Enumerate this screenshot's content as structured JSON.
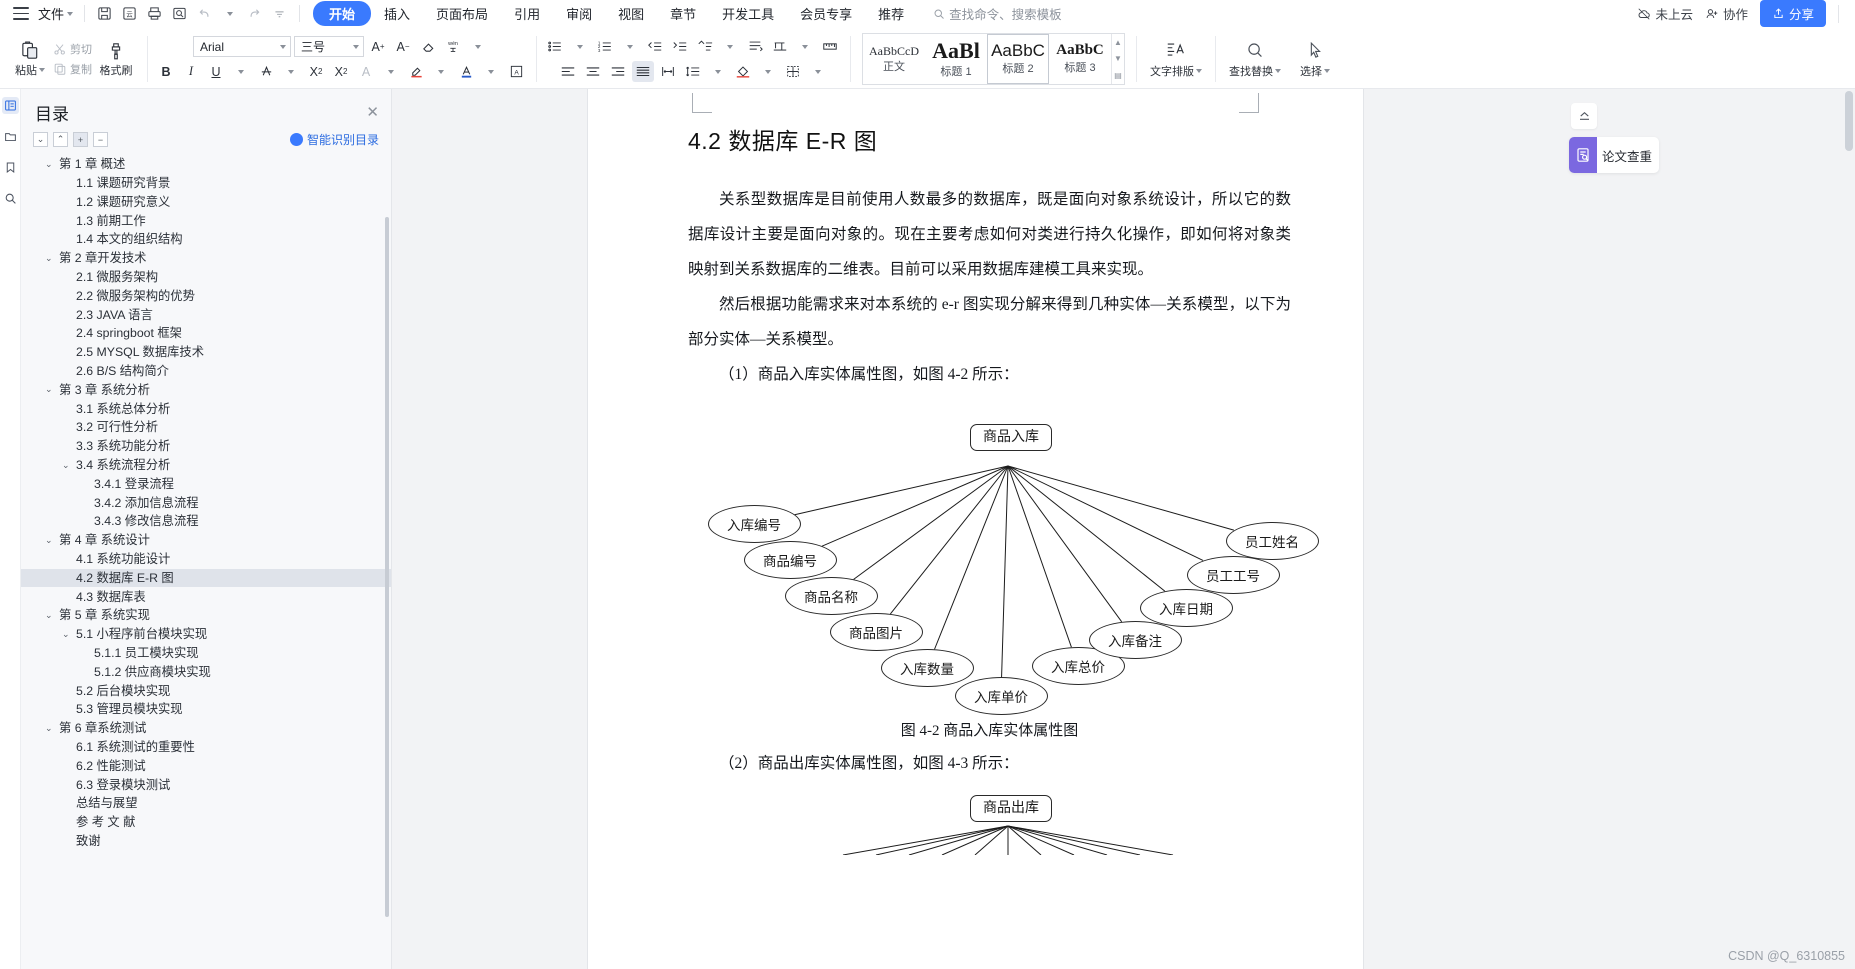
{
  "menubar": {
    "file_label": "文件",
    "quick_icons": [
      "save-icon",
      "save-as-cloud-icon",
      "print-icon",
      "print-preview-icon",
      "undo-icon",
      "redo-icon",
      "customize-icon"
    ],
    "tabs": [
      {
        "label": "开始",
        "active": true
      },
      {
        "label": "插入",
        "active": false
      },
      {
        "label": "页面布局",
        "active": false
      },
      {
        "label": "引用",
        "active": false
      },
      {
        "label": "审阅",
        "active": false
      },
      {
        "label": "视图",
        "active": false
      },
      {
        "label": "章节",
        "active": false
      },
      {
        "label": "开发工具",
        "active": false
      },
      {
        "label": "会员专享",
        "active": false
      },
      {
        "label": "推荐",
        "active": false
      }
    ],
    "search_placeholder": "查找命令、搜索模板",
    "cloud_status": "未上云",
    "collab_label": "协作",
    "share_label": "分享"
  },
  "ribbon": {
    "paste_label": "粘贴",
    "cut_label": "剪切",
    "copy_label": "复制",
    "format_painter_label": "格式刷",
    "font_name": "Arial",
    "font_size": "三号",
    "styles": [
      {
        "preview": "AaBbCcD",
        "name": "正文",
        "selected": false
      },
      {
        "preview": "AaBl",
        "name": "标题 1",
        "selected": false
      },
      {
        "preview": "AaBbC",
        "name": "标题 2",
        "selected": true
      },
      {
        "preview": "AaBbC",
        "name": "标题 3",
        "selected": false
      }
    ],
    "typeset_label": "文字排版",
    "find_replace_label": "查找替换",
    "select_label": "选择"
  },
  "toc": {
    "title": "目录",
    "smart_label": "智能识别目录",
    "items": [
      {
        "label": "第 1 章  概述",
        "level": 0,
        "chevron": true,
        "selected": false
      },
      {
        "label": "1.1 课题研究背景",
        "level": 1,
        "chevron": false,
        "selected": false
      },
      {
        "label": "1.2 课题研究意义",
        "level": 1,
        "chevron": false,
        "selected": false
      },
      {
        "label": "1.3 前期工作",
        "level": 1,
        "chevron": false,
        "selected": false
      },
      {
        "label": "1.4 本文的组织结构",
        "level": 1,
        "chevron": false,
        "selected": false
      },
      {
        "label": "第 2 章开发技术",
        "level": 0,
        "chevron": true,
        "selected": false
      },
      {
        "label": "2.1 微服务架构",
        "level": 1,
        "chevron": false,
        "selected": false
      },
      {
        "label": "2.2 微服务架构的优势",
        "level": 1,
        "chevron": false,
        "selected": false
      },
      {
        "label": "2.3 JAVA 语言",
        "level": 1,
        "chevron": false,
        "selected": false
      },
      {
        "label": "2.4 springboot 框架",
        "level": 1,
        "chevron": false,
        "selected": false
      },
      {
        "label": "2.5 MYSQL 数据库技术",
        "level": 1,
        "chevron": false,
        "selected": false
      },
      {
        "label": "2.6 B/S 结构简介",
        "level": 1,
        "chevron": false,
        "selected": false
      },
      {
        "label": "第 3 章  系统分析",
        "level": 0,
        "chevron": true,
        "selected": false
      },
      {
        "label": "3.1 系统总体分析",
        "level": 1,
        "chevron": false,
        "selected": false
      },
      {
        "label": "3.2 可行性分析",
        "level": 1,
        "chevron": false,
        "selected": false
      },
      {
        "label": "3.3 系统功能分析",
        "level": 1,
        "chevron": false,
        "selected": false
      },
      {
        "label": "3.4 系统流程分析",
        "level": 1,
        "chevron": true,
        "selected": false
      },
      {
        "label": "3.4.1 登录流程",
        "level": 2,
        "chevron": false,
        "selected": false
      },
      {
        "label": "3.4.2 添加信息流程",
        "level": 2,
        "chevron": false,
        "selected": false
      },
      {
        "label": "3.4.3 修改信息流程",
        "level": 2,
        "chevron": false,
        "selected": false
      },
      {
        "label": "第 4 章  系统设计",
        "level": 0,
        "chevron": true,
        "selected": false
      },
      {
        "label": "4.1 系统功能设计",
        "level": 1,
        "chevron": false,
        "selected": false
      },
      {
        "label": "4.2 数据库 E-R 图",
        "level": 1,
        "chevron": false,
        "selected": true
      },
      {
        "label": "4.3 数据库表",
        "level": 1,
        "chevron": false,
        "selected": false
      },
      {
        "label": "第 5 章  系统实现",
        "level": 0,
        "chevron": true,
        "selected": false
      },
      {
        "label": "5.1 小程序前台模块实现",
        "level": 1,
        "chevron": true,
        "selected": false
      },
      {
        "label": "5.1.1 员工模块实现",
        "level": 2,
        "chevron": false,
        "selected": false
      },
      {
        "label": "5.1.2 供应商模块实现",
        "level": 2,
        "chevron": false,
        "selected": false
      },
      {
        "label": "5.2 后台模块实现",
        "level": 1,
        "chevron": false,
        "selected": false
      },
      {
        "label": "5.3 管理员模块实现",
        "level": 1,
        "chevron": false,
        "selected": false
      },
      {
        "label": "第 6 章系统测试",
        "level": 0,
        "chevron": true,
        "selected": false
      },
      {
        "label": "6.1 系统测试的重要性",
        "level": 1,
        "chevron": false,
        "selected": false
      },
      {
        "label": "6.2 性能测试",
        "level": 1,
        "chevron": false,
        "selected": false
      },
      {
        "label": "6.3 登录模块测试",
        "level": 1,
        "chevron": false,
        "selected": false
      },
      {
        "label": "总结与展望",
        "level": 1,
        "chevron": false,
        "selected": false
      },
      {
        "label": "参 考 文 献",
        "level": 1,
        "chevron": false,
        "selected": false
      },
      {
        "label": "致谢",
        "level": 1,
        "chevron": false,
        "selected": false
      }
    ]
  },
  "document": {
    "heading": "4.2 数据库 E-R 图",
    "para1": "关系型数据库是目前使用人数最多的数据库，既是面向对象系统设计，所以它的数据库设计主要是面向对象的。现在主要考虑如何对类进行持久化操作，即如何将对象类映射到关系数据库的二维表。目前可以采用数据库建模工具来实现。",
    "para2": "然后根据功能需求来对本系统的 e-r 图实现分解来得到几种实体—关系模型，以下为部分实体—关系模型。",
    "list1": "（1）商品入库实体属性图，如图 4-2 所示：",
    "figure1_caption": "图 4-2 商品入库实体属性图",
    "list2": "（2）商品出库实体属性图，如图 4-3 所示：",
    "er1": {
      "entity": "商品入库",
      "attributes": [
        "入库编号",
        "商品编号",
        "商品名称",
        "商品图片",
        "入库数量",
        "入库单价",
        "入库总价",
        "入库备注",
        "入库日期",
        "员工工号",
        "员工姓名"
      ]
    },
    "er2": {
      "entity": "商品出库"
    }
  },
  "rightpane": {
    "collapse_icon": "collapse-up-icon",
    "plugin_label": "论文查重"
  },
  "watermark": "CSDN @Q_6310855",
  "colors": {
    "accent": "#3a7afe",
    "plugin": "#7b68e0",
    "selection": "#dfe3ea",
    "panel_bg": "#f7f8fa",
    "workspace_bg": "#f2f3f5"
  }
}
